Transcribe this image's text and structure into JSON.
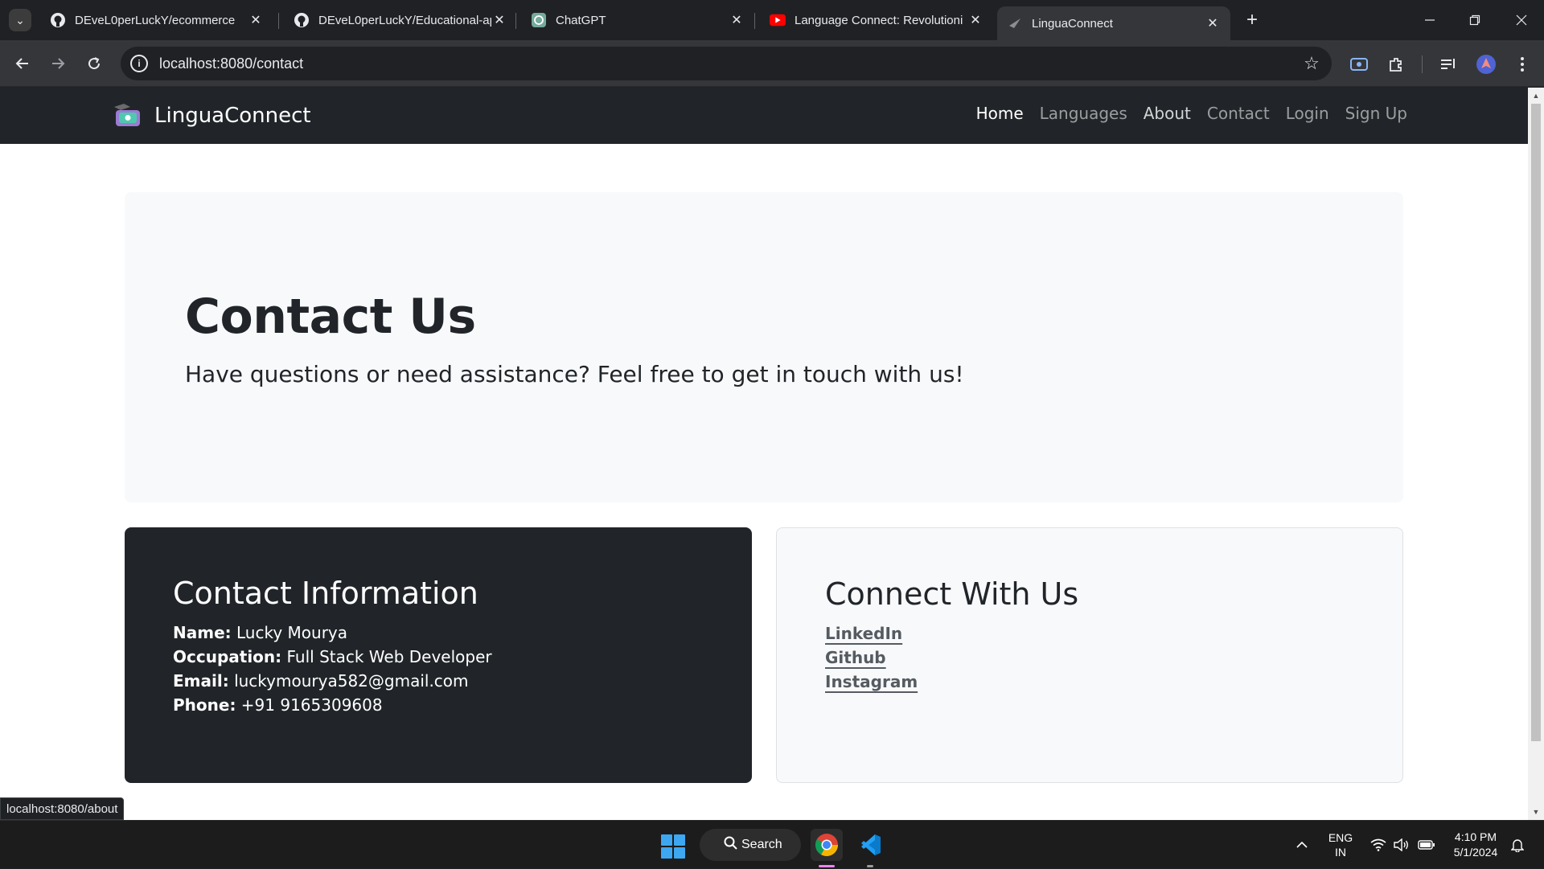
{
  "browser": {
    "tabs": [
      {
        "title": "DEveL0perLuckY/ecommerce",
        "icon": "github-icon",
        "active": false
      },
      {
        "title": "DEveL0perLuckY/Educational-ap",
        "icon": "github-icon",
        "active": false
      },
      {
        "title": "ChatGPT",
        "icon": "chatgpt-icon",
        "active": false
      },
      {
        "title": "Language Connect: Revolutioni",
        "icon": "youtube-icon",
        "active": false
      },
      {
        "title": "LinguaConnect",
        "icon": "page-icon",
        "active": true
      }
    ],
    "new_tab_symbol": "+",
    "url": "localhost:8080/contact",
    "status_url": "localhost:8080/about",
    "profile_color": "#4f63d2"
  },
  "site": {
    "brand": "LinguaConnect",
    "nav": [
      "Home",
      "Languages",
      "About",
      "Contact",
      "Login",
      "Sign Up"
    ],
    "active_nav": "Home",
    "hero": {
      "title": "Contact Us",
      "subtitle": "Have questions or need assistance? Feel free to get in touch with us!"
    },
    "contact": {
      "title": "Contact Information",
      "name_label": "Name:",
      "name": "Lucky Mourya",
      "occupation_label": "Occupation:",
      "occupation": "Full Stack Web Developer",
      "email_label": "Email:",
      "email": "luckymourya582@gmail.com",
      "phone_label": "Phone:",
      "phone": "+91 9165309608"
    },
    "connect": {
      "title": "Connect With Us",
      "links": [
        "LinkedIn",
        "Github",
        "Instagram"
      ]
    }
  },
  "taskbar": {
    "search_label": "Search",
    "lang_top": "ENG",
    "lang_bottom": "IN",
    "time": "4:10 PM",
    "date": "5/1/2024"
  },
  "colors": {
    "navbar_bg": "#212529",
    "hero_bg": "#f8f9fa",
    "dark_card": "#212529",
    "windows_blue": "#3da7f2"
  }
}
